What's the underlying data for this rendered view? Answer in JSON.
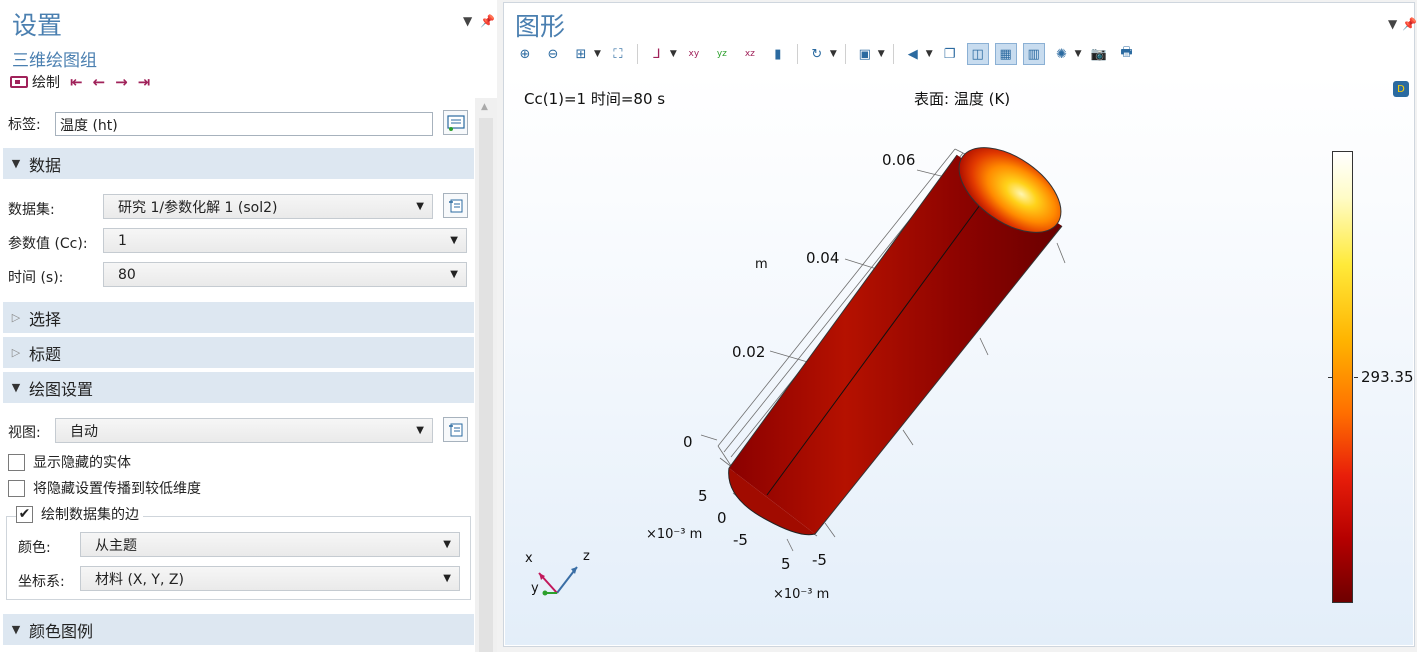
{
  "settings": {
    "title": "设置",
    "subtitle": "三维绘图组",
    "plot_label": "绘制",
    "label_field": {
      "label": "标签:",
      "value": "温度 (ht)"
    },
    "sections": {
      "data": "数据",
      "selection": "选择",
      "title": "标题",
      "plot_settings": "绘图设置",
      "color_legend": "颜色图例"
    },
    "dataset": {
      "label": "数据集:",
      "value": "研究 1/参数化解 1 (sol2)"
    },
    "param_value": {
      "label": "参数值 (Cc):",
      "value": "1"
    },
    "time": {
      "label": "时间 (s):",
      "value": "80"
    },
    "view": {
      "label": "视图:",
      "value": "自动"
    },
    "show_hidden": {
      "label": "显示隐藏的实体",
      "checked": false
    },
    "propagate_hidden": {
      "label": "将隐藏设置传播到较低维度",
      "checked": false
    },
    "plot_edges": {
      "label": "绘制数据集的边",
      "checked": true
    },
    "color": {
      "label": "颜色:",
      "value": "从主题"
    },
    "coord_system": {
      "label": "坐标系:",
      "value": "材料  (X, Y, Z)"
    }
  },
  "graphics": {
    "title": "图形",
    "info_left": "Cc(1)=1 时间=80 s",
    "info_right": "表面: 温度 (K)",
    "axis_ticks_z": [
      "0.06",
      "0.04",
      "0.02",
      "0"
    ],
    "axis_unit_z": "m",
    "axis_ticks_x": [
      "5",
      "0",
      "-5"
    ],
    "axis_ticks_y": [
      "5",
      "-5"
    ],
    "axis_unit_scaled": "×10⁻³ m",
    "colorbar_value": "293.35",
    "triad": {
      "x": "x",
      "y": "y",
      "z": "z"
    }
  },
  "colors": {
    "accent": "#4a7fb0",
    "section_bg": "#dde7f1",
    "cylinder_dark": "#7a0000",
    "cylinder_mid": "#b30d00"
  }
}
